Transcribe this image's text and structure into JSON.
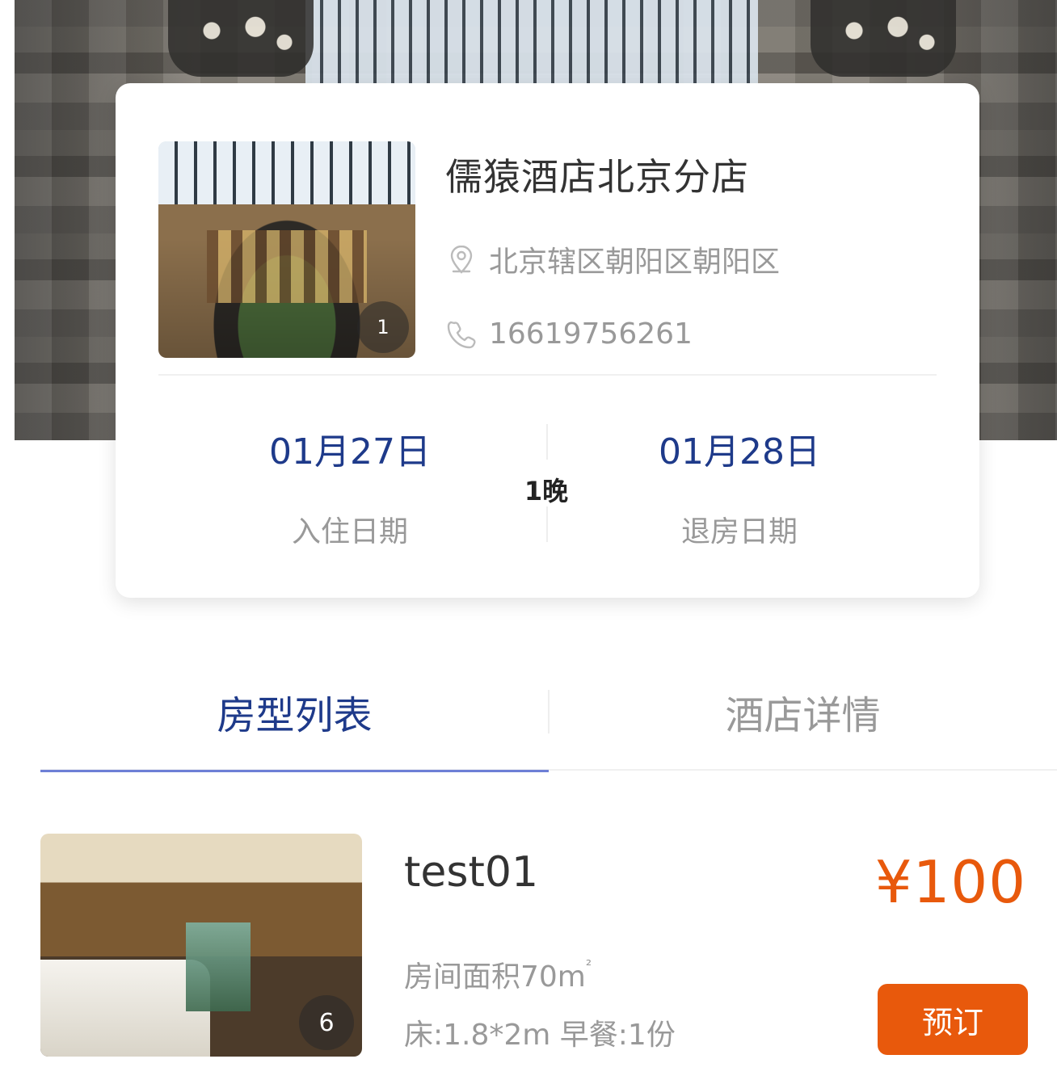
{
  "hotel": {
    "name": "儒猿酒店北京分店",
    "address": "北京辖区朝阳区朝阳区",
    "phone": "16619756261",
    "image_count": "1"
  },
  "stay": {
    "checkin_date": "01月27日",
    "checkin_label": "入住日期",
    "checkout_date": "01月28日",
    "checkout_label": "退房日期",
    "nights": "1晚"
  },
  "tabs": [
    {
      "label": "房型列表",
      "active": true
    },
    {
      "label": "酒店详情",
      "active": false
    }
  ],
  "rooms": [
    {
      "name": "test01",
      "price": "¥100",
      "area": "房间面积70m",
      "area_sup": "²",
      "bed_breakfast": "床:1.8*2m 早餐:1份",
      "image_count": "6",
      "book_label": "预订"
    }
  ],
  "colors": {
    "primary_blue": "#1e3a8a",
    "tab_underline": "#6d7fd6",
    "price_orange": "#e8590c"
  },
  "icons": [
    "location-pin-icon",
    "phone-icon"
  ]
}
